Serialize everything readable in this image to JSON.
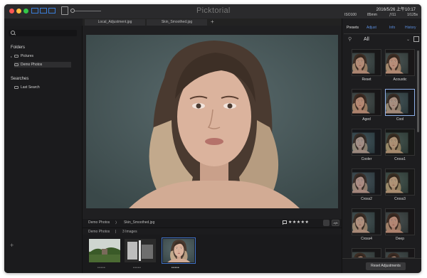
{
  "app": {
    "title": "Picktorial",
    "datetime": "2016/5/26 上午10:17"
  },
  "tabs": [
    {
      "label": "Local_Adjustment.jpg"
    },
    {
      "label": "Skin_Smoothed.jpg"
    }
  ],
  "tab_add": "+",
  "exif": {
    "iso": "ISO100",
    "focal": "85mm",
    "aperture": "ƒ/11",
    "shutter": "1/125s"
  },
  "sidebar": {
    "folders_heading": "Folders",
    "folders": [
      {
        "label": "Pictures"
      },
      {
        "label": "Demo Photos"
      }
    ],
    "searches_heading": "Searches",
    "searches": [
      {
        "label": "Last Search"
      }
    ],
    "add_label": "+"
  },
  "infobar": {
    "album": "Demo Photos",
    "separator": "〉",
    "filename": "Skin_Smoothed.jpg",
    "stars": "★★★★★",
    "ab_label": "A|B"
  },
  "filmstrip": {
    "album": "Demo Photos",
    "divider": "|",
    "count": "3 Images",
    "dots": "•••••"
  },
  "right_panel": {
    "tabs": [
      {
        "label": "Presets",
        "active": true
      },
      {
        "label": "Adjust",
        "active": false
      },
      {
        "label": "Info",
        "active": false
      },
      {
        "label": "History",
        "active": false
      }
    ],
    "filter": "All",
    "filter_dropdown": "⌄",
    "presets": [
      {
        "label": "Reset",
        "tint": "#7a5e4f"
      },
      {
        "label": "Acoustic",
        "tint": "#8a6a55"
      },
      {
        "label": "Aged",
        "tint": "#7d4f3a"
      },
      {
        "label": "Cool",
        "tint": "#4e6a74"
      },
      {
        "label": "Cooler",
        "tint": "#3f6a92"
      },
      {
        "label": "Cross1",
        "tint": "#5d6e3f"
      },
      {
        "label": "Cross2",
        "tint": "#5b5f8a"
      },
      {
        "label": "Cross3",
        "tint": "#6b7a46"
      },
      {
        "label": "Cross4",
        "tint": "#6c7070"
      },
      {
        "label": "Deep",
        "tint": "#7a4a3e"
      },
      {
        "label": "",
        "tint": "#7a5a4a"
      },
      {
        "label": "",
        "tint": "#6e4e44"
      }
    ],
    "selected_preset": "Cool",
    "reset_button": "Reset Adjustments"
  },
  "colors": {
    "accent": "#3f72c8",
    "tab_active": "#5b8fe0",
    "background": "#1c1c1e"
  }
}
